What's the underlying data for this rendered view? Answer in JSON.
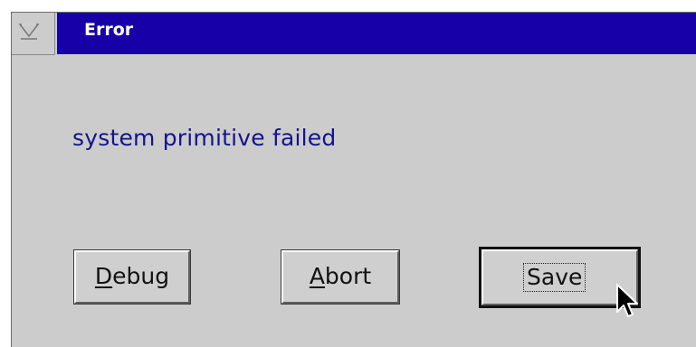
{
  "dialog": {
    "title": "Error",
    "message": "system primitive failed"
  },
  "buttons": {
    "debug": {
      "mnemonic": "D",
      "rest": "ebug"
    },
    "abort": {
      "mnemonic": "A",
      "rest": "bort"
    },
    "save": {
      "label": "Save",
      "focused": true
    }
  },
  "icons": {
    "system_menu": "system-menu-icon",
    "cursor": "mouse-pointer-icon"
  },
  "colors": {
    "titlebar": "#1700a8",
    "window_bg": "#cccccc",
    "message_text": "#14148c"
  }
}
